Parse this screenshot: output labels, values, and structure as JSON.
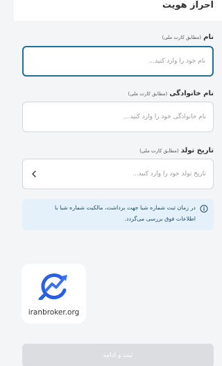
{
  "header": {
    "title": "احراز هویت"
  },
  "fields": [
    {
      "label": "نام",
      "hint": "(مطابق کارت ملی)",
      "placeholder": "نام خود را وارد کنید..."
    },
    {
      "label": "نام خانوادگی",
      "hint": "(مطابق کارت ملی)",
      "placeholder": "نام خانوادگی خود را وارد کنید..."
    },
    {
      "label": "تاریخ تولد",
      "hint": "(مطابق کارت ملی)",
      "placeholder": "تاریخ تولد خود را وارد کنید..."
    }
  ],
  "info": {
    "line1": "در زمان ثبت شماره شبا جهت برداشت، مالکیت شماره شبا با",
    "line2": "اطلاعات فوق بررسی می‌گردد."
  },
  "logo": {
    "text": "iranbroker.org"
  },
  "submit": {
    "label": "ثبت و ادامه"
  },
  "colors": {
    "focus_border": "#1f6f93",
    "info_bg": "#e4f1fb",
    "button_disabled": "#dcdde0",
    "logo_blue": "#2a5ee6"
  }
}
